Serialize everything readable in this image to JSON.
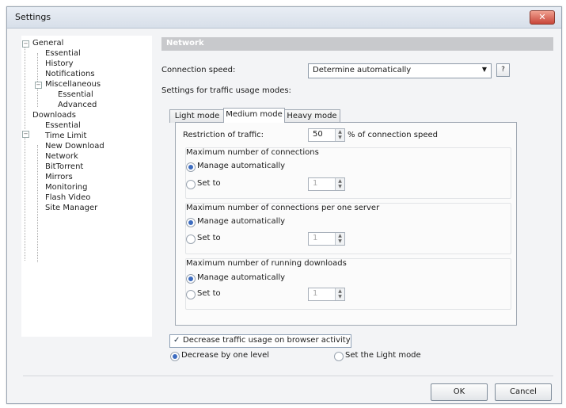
{
  "window": {
    "title": "Settings"
  },
  "tree": {
    "items": [
      {
        "label": "General"
      },
      {
        "label": "Essential"
      },
      {
        "label": "History"
      },
      {
        "label": "Notifications"
      },
      {
        "label": "Miscellaneous"
      },
      {
        "label": "Essential"
      },
      {
        "label": "Advanced"
      },
      {
        "label": "Downloads"
      },
      {
        "label": "Essential"
      },
      {
        "label": "Time Limit"
      },
      {
        "label": "New Download"
      },
      {
        "label": "Network"
      },
      {
        "label": "BitTorrent"
      },
      {
        "label": "Mirrors"
      },
      {
        "label": "Monitoring"
      },
      {
        "label": "Flash Video"
      },
      {
        "label": "Site Manager"
      }
    ]
  },
  "main": {
    "section_title": "Network",
    "connection_speed_label": "Connection speed:",
    "connection_speed_value": "Determine automatically",
    "help_label": "?",
    "traffic_modes_label": "Settings for traffic usage modes:",
    "tabs": [
      {
        "label": "Light mode",
        "active": false
      },
      {
        "label": "Medium mode",
        "active": true
      },
      {
        "label": "Heavy mode",
        "active": false
      }
    ],
    "restriction_label": "Restriction of traffic:",
    "restriction_value": "50",
    "restriction_suffix": "% of connection speed",
    "groups": [
      {
        "title": "Maximum number of connections",
        "auto_label": "Manage automatically",
        "set_label": "Set to",
        "set_value": "1"
      },
      {
        "title": "Maximum number of connections per one server",
        "auto_label": "Manage automatically",
        "set_label": "Set to",
        "set_value": "1"
      },
      {
        "title": "Maximum number of running downloads",
        "auto_label": "Manage automatically",
        "set_label": "Set to",
        "set_value": "1"
      }
    ],
    "decrease_check_label": "Decrease traffic usage on browser activity",
    "decrease_one_label": "Decrease by one level",
    "set_light_label": "Set the Light mode"
  },
  "buttons": {
    "ok": "OK",
    "cancel": "Cancel"
  }
}
